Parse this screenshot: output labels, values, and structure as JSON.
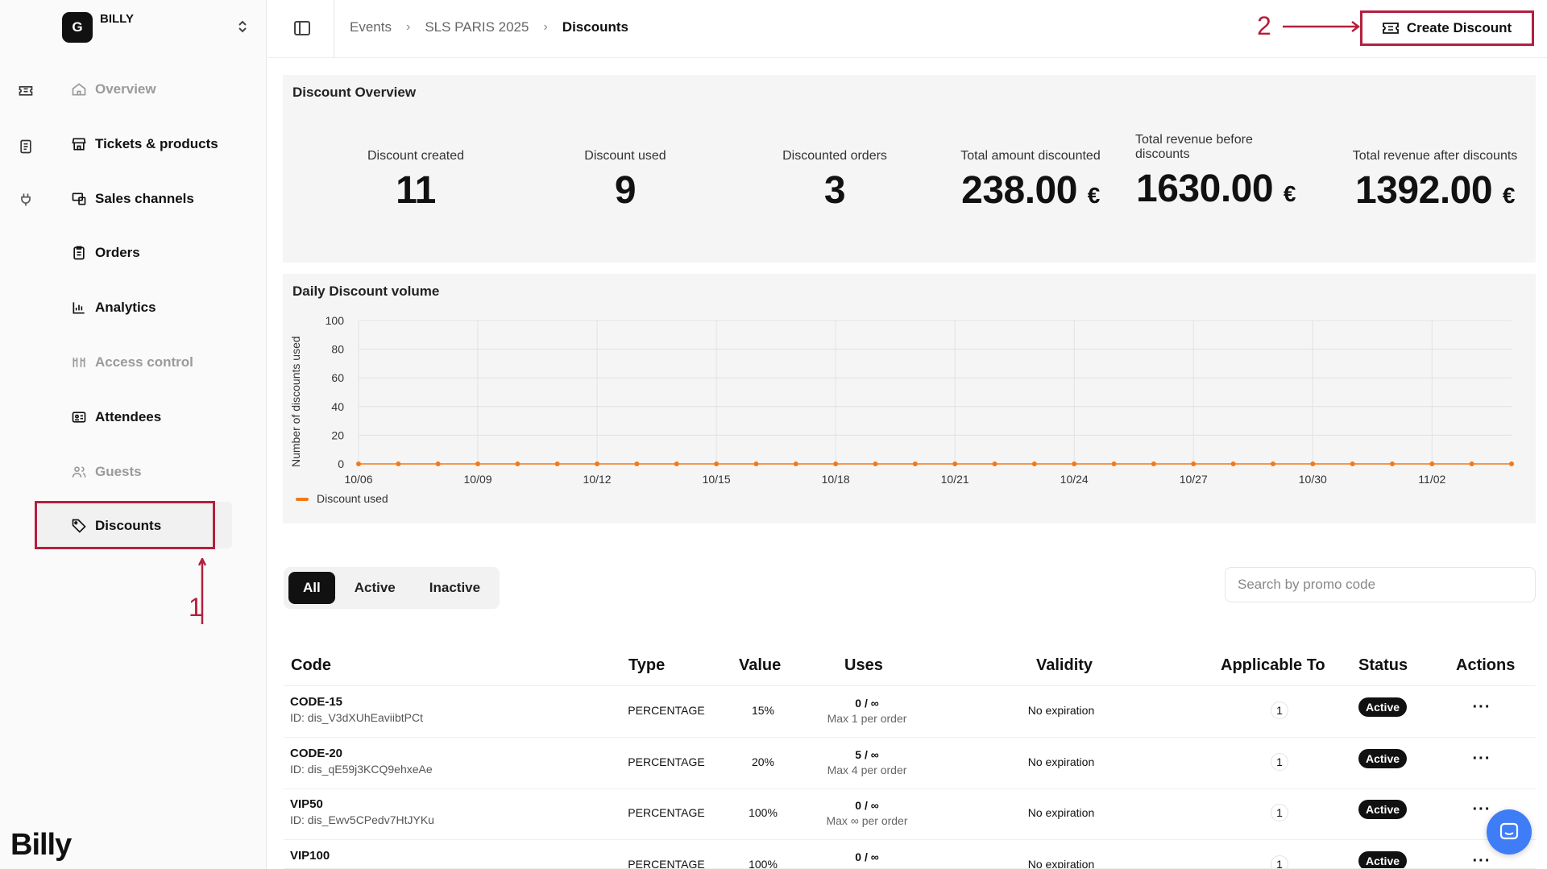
{
  "org": {
    "avatar_letter": "G",
    "name": "BILLY"
  },
  "brand": "Billy",
  "nav": {
    "items": [
      {
        "label": "Overview",
        "icon": "home-icon",
        "muted": true
      },
      {
        "label": "Tickets & products",
        "icon": "store-icon"
      },
      {
        "label": "Sales channels",
        "icon": "channels-icon"
      },
      {
        "label": "Orders",
        "icon": "clipboard-icon"
      },
      {
        "label": "Analytics",
        "icon": "bar-chart-icon"
      },
      {
        "label": "Access control",
        "icon": "gates-icon",
        "muted": true
      },
      {
        "label": "Attendees",
        "icon": "id-card-icon"
      },
      {
        "label": "Guests",
        "icon": "users-icon",
        "muted": true
      },
      {
        "label": "Discounts",
        "icon": "tag-icon",
        "active": true
      }
    ]
  },
  "annotations": {
    "step1": "1",
    "step2": "2"
  },
  "breadcrumb": [
    "Events",
    "SLS PARIS 2025",
    "Discounts"
  ],
  "header": {
    "create_label": "Create Discount"
  },
  "overview": {
    "title": "Discount Overview",
    "stats": [
      {
        "label": "Discount created",
        "value": "11",
        "currency": ""
      },
      {
        "label": "Discount used",
        "value": "9",
        "currency": ""
      },
      {
        "label": "Discounted orders",
        "value": "3",
        "currency": ""
      },
      {
        "label": "Total amount discounted",
        "value": "238.00",
        "currency": "€"
      },
      {
        "label": "Total revenue before discounts",
        "value": "1630.00",
        "currency": "€"
      },
      {
        "label": "Total revenue after discounts",
        "value": "1392.00",
        "currency": "€"
      }
    ]
  },
  "chart_data": {
    "type": "line",
    "title": "Daily Discount volume",
    "ylabel": "Number of discounts used",
    "xlabel": "",
    "ylim": [
      0,
      100
    ],
    "y_ticks": [
      0,
      20,
      40,
      60,
      80,
      100
    ],
    "x_ticks": [
      "10/06",
      "10/09",
      "10/12",
      "10/15",
      "10/18",
      "10/21",
      "10/24",
      "10/27",
      "10/30",
      "11/02"
    ],
    "x": [
      "10/06",
      "10/07",
      "10/08",
      "10/09",
      "10/10",
      "10/11",
      "10/12",
      "10/13",
      "10/14",
      "10/15",
      "10/16",
      "10/17",
      "10/18",
      "10/19",
      "10/20",
      "10/21",
      "10/22",
      "10/23",
      "10/24",
      "10/25",
      "10/26",
      "10/27",
      "10/28",
      "10/29",
      "10/30",
      "10/31",
      "11/01",
      "11/02",
      "11/03",
      "11/04"
    ],
    "series": [
      {
        "name": "Discount used",
        "color": "#f07a1a",
        "values": [
          0,
          0,
          0,
          0,
          0,
          0,
          0,
          0,
          0,
          0,
          0,
          0,
          0,
          0,
          0,
          0,
          0,
          0,
          0,
          0,
          0,
          0,
          0,
          0,
          0,
          0,
          0,
          0,
          0,
          0
        ]
      }
    ],
    "legend": "bottom-left",
    "grid": true
  },
  "filters": {
    "tabs": [
      "All",
      "Active",
      "Inactive"
    ],
    "active": "All"
  },
  "search": {
    "placeholder": "Search by promo code",
    "value": ""
  },
  "table": {
    "columns": [
      "Code",
      "Type",
      "Value",
      "Uses",
      "Validity",
      "Applicable To",
      "Status",
      "Actions"
    ],
    "rows": [
      {
        "code": "CODE-15",
        "id": "ID: dis_V3dXUhEaviibtPCt",
        "type": "PERCENTAGE",
        "value": "15%",
        "uses": "0 / ∞",
        "max": "Max 1 per order",
        "validity": "No expiration",
        "applicable": "1",
        "status": "Active",
        "actions": "···"
      },
      {
        "code": "CODE-20",
        "id": "ID: dis_qE59j3KCQ9ehxeAe",
        "type": "PERCENTAGE",
        "value": "20%",
        "uses": "5 / ∞",
        "max": "Max 4 per order",
        "validity": "No expiration",
        "applicable": "1",
        "status": "Active",
        "actions": "···"
      },
      {
        "code": "VIP50",
        "id": "ID: dis_Ewv5CPedv7HtJYKu",
        "type": "PERCENTAGE",
        "value": "100%",
        "uses": "0 / ∞",
        "max": "Max ∞ per order",
        "validity": "No expiration",
        "applicable": "1",
        "status": "Active",
        "actions": "···"
      },
      {
        "code": "VIP100",
        "id": "",
        "type": "PERCENTAGE",
        "value": "100%",
        "uses": "0 / ∞",
        "max": "",
        "validity": "No expiration",
        "applicable": "1",
        "status": "Active",
        "actions": "···"
      }
    ]
  },
  "colors": {
    "accent_red": "#b3203e",
    "chart_line": "#f07a1a",
    "chat": "#3f7df6"
  }
}
